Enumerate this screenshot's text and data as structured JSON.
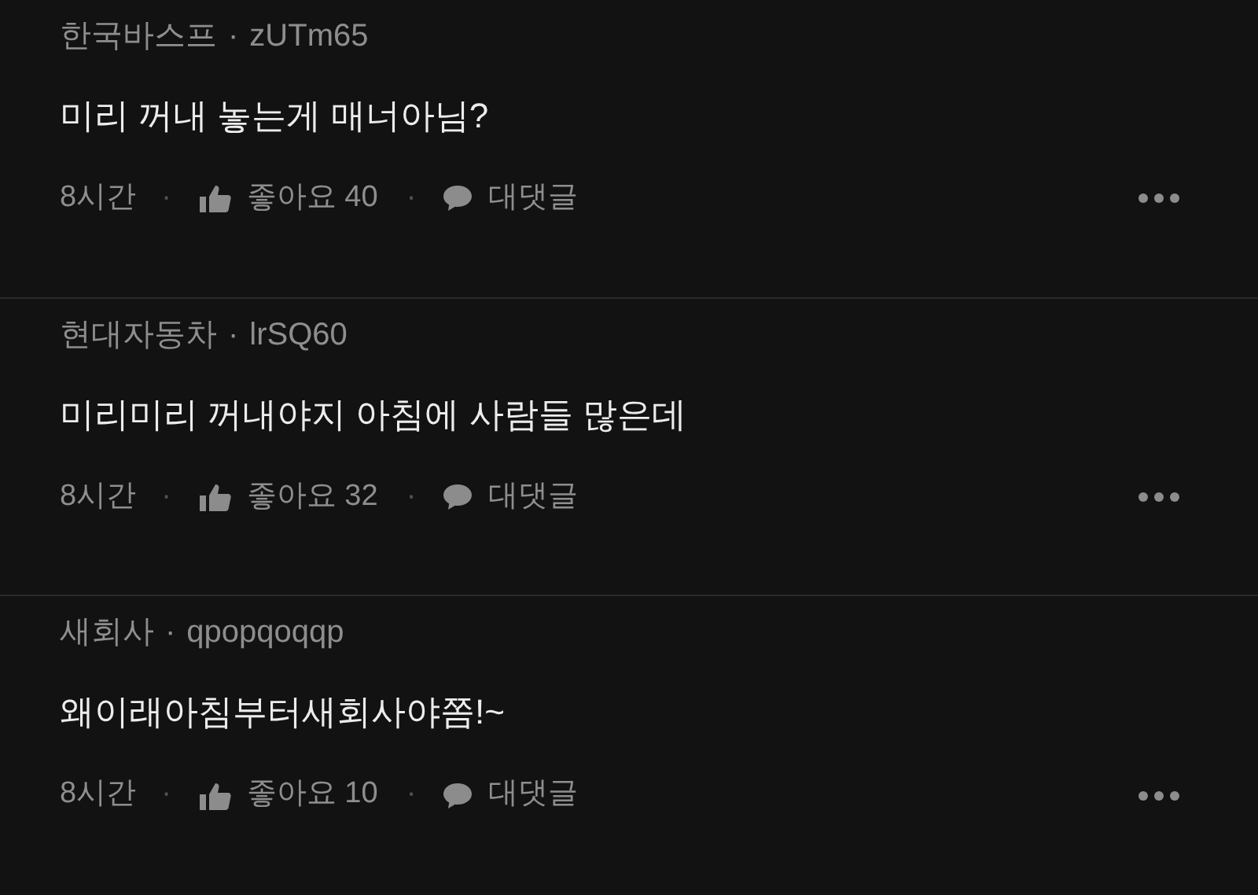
{
  "comments": [
    {
      "company": "한국바스프",
      "separator": "·",
      "user": "zUTm65",
      "body": "미리 꺼내 놓는게 매너아님?",
      "time": "8시간",
      "dot1": "·",
      "like": "좋아요 40",
      "dot2": "·",
      "reply": "대댓글"
    },
    {
      "company": "현대자동차",
      "separator": "·",
      "user": "lrSQ60",
      "body": "미리미리 꺼내야지 아침에 사람들 많은데",
      "time": "8시간",
      "dot1": "·",
      "like": "좋아요 32",
      "dot2": "·",
      "reply": "대댓글"
    },
    {
      "company": "새회사",
      "separator": "·",
      "user": "qpopqoqqp",
      "body": "왜이래아침부터새회사야쫌!~",
      "time": "8시간",
      "dot1": "·",
      "like": "좋아요 10",
      "dot2": "·",
      "reply": "대댓글"
    }
  ]
}
